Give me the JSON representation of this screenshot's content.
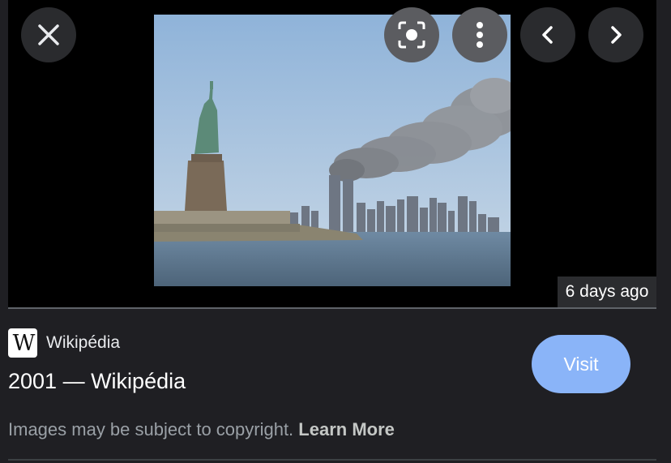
{
  "viewer": {
    "close_icon": "close-icon",
    "lens_icon": "lens-icon",
    "more_icon": "more-vert-icon",
    "prev_icon": "chevron-left-icon",
    "next_icon": "chevron-right-icon",
    "timestamp": "6 days ago"
  },
  "result": {
    "source_logo_text": "W",
    "source_name": "Wikipédia",
    "title": "2001 — Wikipédia",
    "visit_label": "Visit",
    "copyright_text": "Images may be subject to copyright. ",
    "learn_more_label": "Learn More"
  },
  "colors": {
    "background": "#1f1f23",
    "viewer_bg": "#000000",
    "visit_button": "#8ab4f8"
  }
}
